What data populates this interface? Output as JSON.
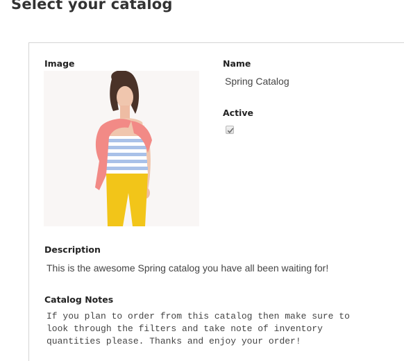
{
  "page": {
    "title": "Select your catalog"
  },
  "catalog": {
    "image_label": "Image",
    "name_label": "Name",
    "name_value": "Spring Catalog",
    "active_label": "Active",
    "active_checked": true,
    "description_label": "Description",
    "description_value": "This is the awesome Spring catalog you have all been waiting for!",
    "notes_label": "Catalog Notes",
    "notes_lines": [
      "If you plan to order from this catalog then make sure to",
      "look through the filters and take note of inventory",
      "quantities please. Thanks and enjoy your order!"
    ]
  },
  "colors": {
    "cardigan": "#f28a86",
    "top_stripe": "#a9c1e8",
    "pants": "#f2c519",
    "skin": "#f0c6ae",
    "hair": "#4a3228"
  }
}
